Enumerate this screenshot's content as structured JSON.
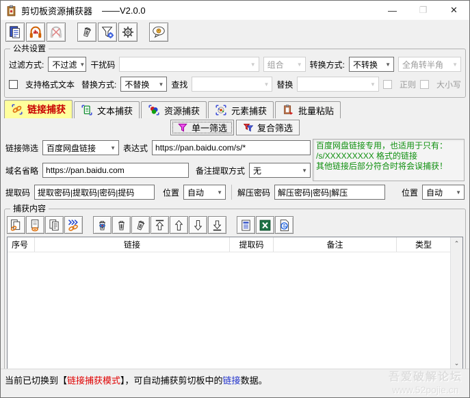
{
  "window": {
    "title": "剪切板资源捕获器",
    "version": "——V2.0.0"
  },
  "titlebar": {
    "minimize_icon": "—",
    "maximize_icon": "❐",
    "close_icon": "✕"
  },
  "toolbar": {
    "icons": [
      "paste",
      "start-monitor",
      "stop-monitor",
      "clear",
      "filter-settings",
      "settings",
      "about"
    ]
  },
  "common": {
    "title": "公共设置",
    "filter_mode_label": "过滤方式:",
    "filter_mode_value": "不过滤",
    "noise_label": "干扰码",
    "noise_value": "",
    "combine_value": "组合",
    "convert_mode_label": "转换方式:",
    "convert_mode_value": "不转换",
    "fullwidth_value": "全角转半角",
    "rich_text_label": "支持格式文本",
    "replace_mode_label": "替换方式:",
    "replace_mode_value": "不替换",
    "find_label": "查找",
    "find_value": "",
    "replace_label": "替换",
    "replace_value": "",
    "regex_label": "正则",
    "case_label": "大小写"
  },
  "tabs": [
    {
      "label": "链接捕获",
      "active": true
    },
    {
      "label": "文本捕获",
      "active": false
    },
    {
      "label": "资源捕获",
      "active": false
    },
    {
      "label": "元素捕获",
      "active": false
    },
    {
      "label": "批量粘贴",
      "active": false
    }
  ],
  "filter_buttons": {
    "single": "单一筛选",
    "compound": "复合筛选"
  },
  "link_panel": {
    "link_filter_label": "链接筛选",
    "link_filter_value": "百度网盘链接",
    "expression_label": "表达式",
    "expression_value": "https://pan.baidu.com/s/*",
    "hint_line1": "百度网盘链接专用，也适用于只有：",
    "hint_line2": "/s/XXXXXXXXX 格式的链接",
    "hint_line3": "其他链接后部分符合时将会误捕获！",
    "domain_label": "域名省略",
    "domain_value": "https://pan.baidu.com",
    "note_mode_label": "备注提取方式",
    "note_mode_value": "无",
    "code_label": "提取码",
    "code_value": "提取密码|提取码|密码|提码",
    "code_pos_label": "位置",
    "code_pos_value": "自动",
    "unzip_label": "解压密码",
    "unzip_value": "解压密码|密码|解压",
    "unzip_pos_label": "位置",
    "unzip_pos_value": "自动"
  },
  "capture": {
    "title": "捕获内容",
    "toolbar_icons": [
      "copy-link",
      "copy-selected",
      "copy-all",
      "open-links",
      "delete-selected",
      "delete-row",
      "clear-all",
      "move-top",
      "move-up",
      "move-down",
      "move-bottom",
      "export-text",
      "export-excel",
      "open-in-browser"
    ],
    "columns": [
      "序号",
      "链接",
      "提取码",
      "备注",
      "类型"
    ]
  },
  "status": {
    "part1": "当前已切换到【",
    "mode": "链接捕获模式",
    "part2": "】，可自动捕获剪切板中的",
    "link": "链接",
    "part3": "数据。"
  },
  "watermark": {
    "line1": "吾爱破解论坛",
    "line2": "www.52pojie.cn"
  },
  "colors": {
    "active_tab_bg": "#ffff9c",
    "active_tab_text": "#c80000",
    "hint_green": "#0f8f0f",
    "status_red": "#e00000",
    "status_blue": "#2233cc"
  }
}
